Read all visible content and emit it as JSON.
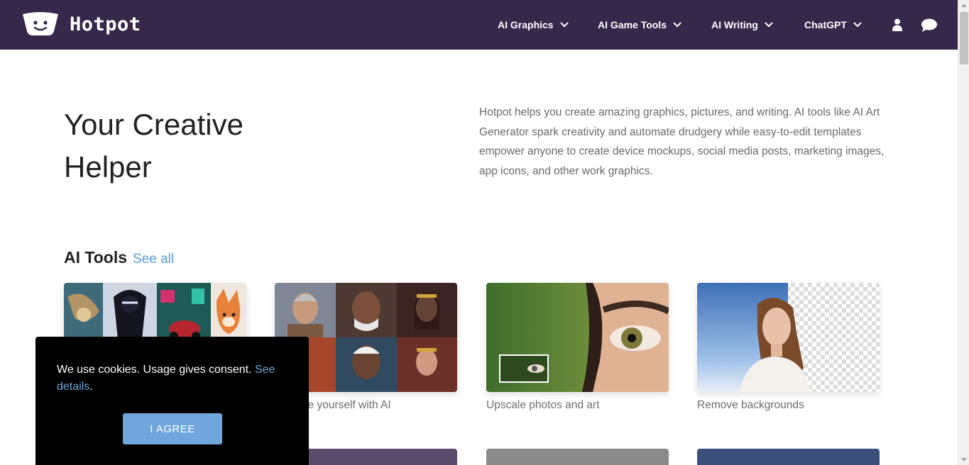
{
  "header": {
    "logo_text": "Hotpot",
    "nav": [
      {
        "label": "AI Graphics"
      },
      {
        "label": "AI Game Tools"
      },
      {
        "label": "AI Writing"
      },
      {
        "label": "ChatGPT"
      }
    ],
    "icons": [
      "user-icon",
      "chat-icon"
    ],
    "background_color": "#35284a"
  },
  "hero": {
    "title": "Your Creative Helper",
    "description": "Hotpot helps you create amazing graphics, pictures, and writing. AI tools like AI Art Generator spark creativity and automate drudgery while easy-to-edit templates empower anyone to create device mockups, social media posts, marketing images, app icons, and other work graphics."
  },
  "tools_section": {
    "title": "AI Tools",
    "see_all": "See all",
    "cards": [
      {
        "caption": ""
      },
      {
        "caption": "Imagine yourself with AI"
      },
      {
        "caption": "Upscale photos and art"
      },
      {
        "caption": "Remove backgrounds"
      }
    ]
  },
  "cookie_banner": {
    "text": "We use cookies. Usage gives consent.",
    "link_text": "See details",
    "after_link": ".",
    "button_label": "I AGREE"
  },
  "colors": {
    "accent_link": "#5b9bd5",
    "cookie_button": "#6fa7dc"
  }
}
